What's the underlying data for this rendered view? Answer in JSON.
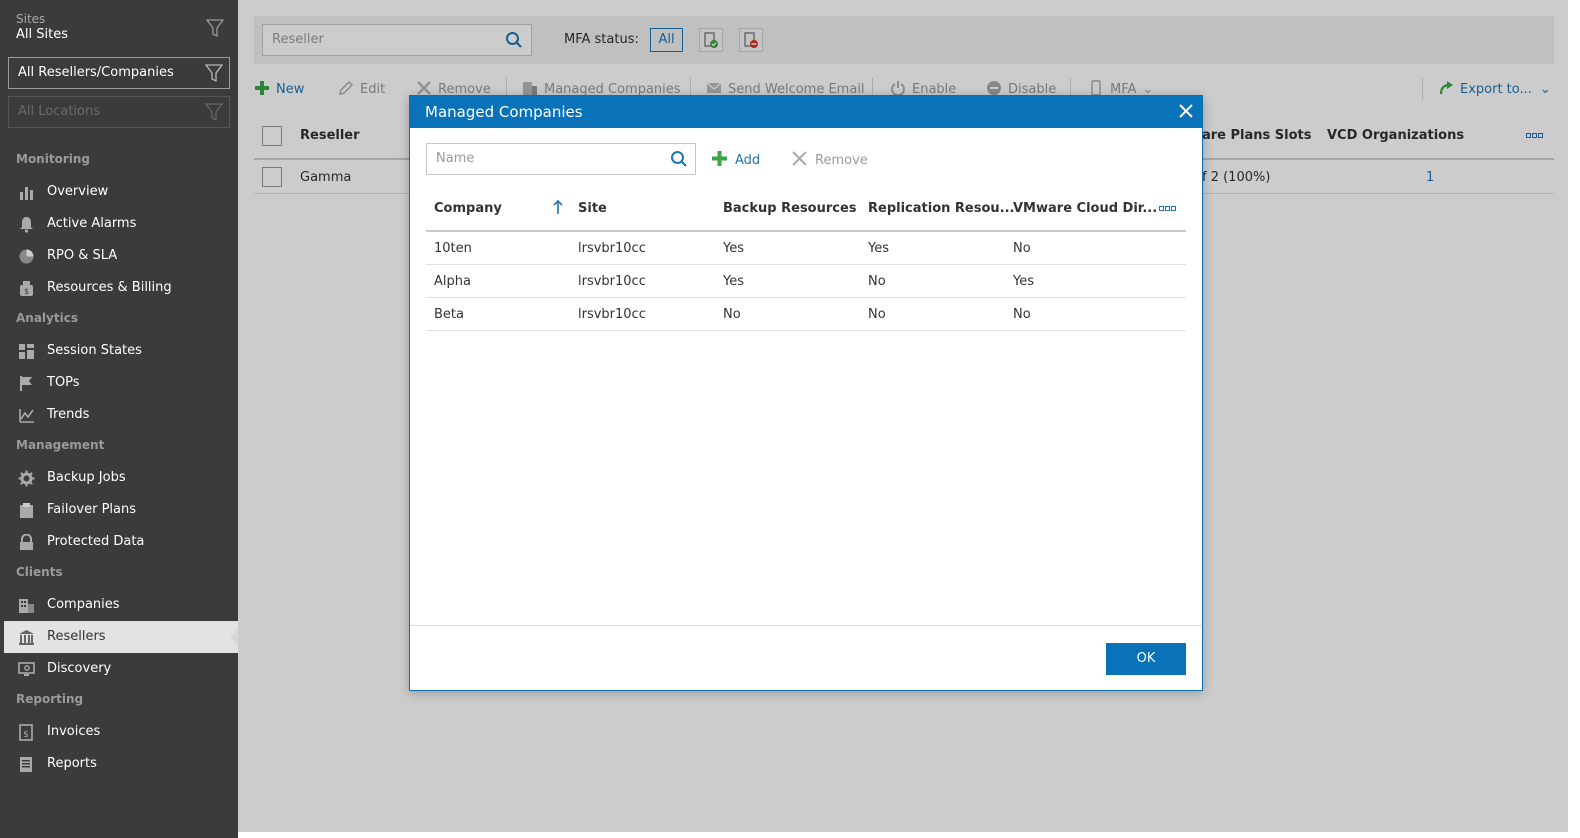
{
  "sidebar": {
    "sites_label": "Sites",
    "sites_value": "All Sites",
    "reseller_filter": "All Resellers/Companies",
    "locations_filter": "All Locations",
    "sections": {
      "monitoring": "Monitoring",
      "analytics": "Analytics",
      "management": "Management",
      "clients": "Clients",
      "reporting": "Reporting"
    },
    "items": {
      "overview": "Overview",
      "active_alarms": "Active Alarms",
      "rpo_sla": "RPO & SLA",
      "resources_billing": "Resources & Billing",
      "session_states": "Session States",
      "tops": "TOPs",
      "trends": "Trends",
      "backup_jobs": "Backup Jobs",
      "failover_plans": "Failover Plans",
      "protected_data": "Protected Data",
      "companies": "Companies",
      "resellers": "Resellers",
      "discovery": "Discovery",
      "invoices": "Invoices",
      "reports": "Reports"
    }
  },
  "main": {
    "search_placeholder": "Reseller",
    "mfa_label": "MFA status:",
    "mfa_all": "All",
    "toolbar": {
      "new": "New",
      "edit": "Edit",
      "remove": "Remove",
      "managed_companies": "Managed Companies",
      "send_welcome_email": "Send Welcome Email",
      "enable": "Enable",
      "disable": "Disable",
      "mfa": "MFA",
      "export": "Export to..."
    },
    "grid": {
      "col_reseller": "Reseller",
      "col_plans_slots": "are Plans Slots",
      "col_vcd_orgs": "VCD Organizations",
      "row": {
        "reseller": "Gamma",
        "plans_slots": "f 2 (100%)",
        "vcd_orgs": "1"
      }
    }
  },
  "dialog": {
    "title": "Managed Companies",
    "search_placeholder": "Name",
    "add_label": "Add",
    "remove_label": "Remove",
    "ok_label": "OK",
    "columns": {
      "company": "Company",
      "site": "Site",
      "backup": "Backup Resources",
      "replication": "Replication Resou...",
      "vcd": "VMware Cloud Dir..."
    },
    "rows": [
      {
        "company": "10ten",
        "site": "lrsvbr10cc",
        "backup": "Yes",
        "replication": "Yes",
        "vcd": "No"
      },
      {
        "company": "Alpha",
        "site": "lrsvbr10cc",
        "backup": "Yes",
        "replication": "No",
        "vcd": "Yes"
      },
      {
        "company": "Beta",
        "site": "lrsvbr10cc",
        "backup": "No",
        "replication": "No",
        "vcd": "No"
      }
    ]
  },
  "colors": {
    "accent": "#0a72b8",
    "sidebar_bg": "#3b3b3b",
    "green": "#3aa545"
  }
}
